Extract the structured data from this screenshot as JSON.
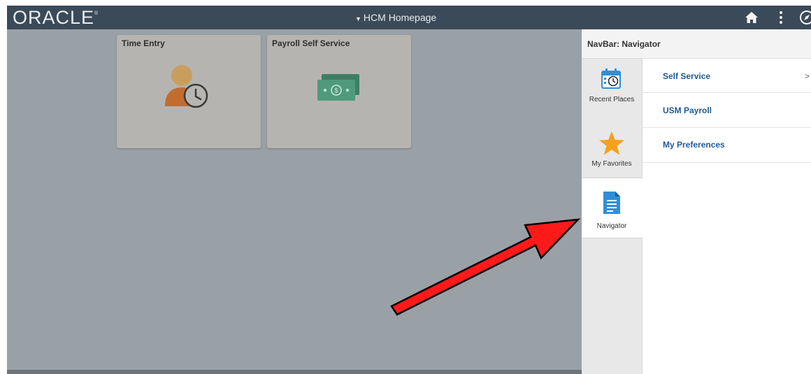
{
  "header": {
    "logo_text": "ORACLE",
    "logo_mark": "®",
    "page_title": "HCM Homepage",
    "caret_icon": "caret-down-icon",
    "icons": [
      "home-icon",
      "actions-menu-icon",
      "navbar-compass-icon"
    ]
  },
  "tiles": [
    {
      "title": "Time Entry",
      "icon": "person-clock-icon"
    },
    {
      "title": "Payroll Self Service",
      "icon": "money-bills-icon"
    }
  ],
  "navbar": {
    "title": "NavBar: Navigator",
    "rail": [
      {
        "label": "Recent Places",
        "icon": "calendar-clock-icon"
      },
      {
        "label": "My Favorites",
        "icon": "star-icon"
      },
      {
        "label": "Navigator",
        "icon": "document-icon",
        "selected": true
      }
    ],
    "menu": [
      {
        "label": "Self Service",
        "chevron": ">"
      },
      {
        "label": "USM Payroll"
      },
      {
        "label": "My Preferences"
      }
    ]
  },
  "annotation": {
    "arrow_color": "#ff0000",
    "points_to": "Navigator"
  },
  "colors": {
    "topbar": "#3b4a58",
    "overlay": "#9aa1a6",
    "link": "#1f5b99",
    "star": "#f4a11d",
    "doc": "#2f8fd8"
  }
}
